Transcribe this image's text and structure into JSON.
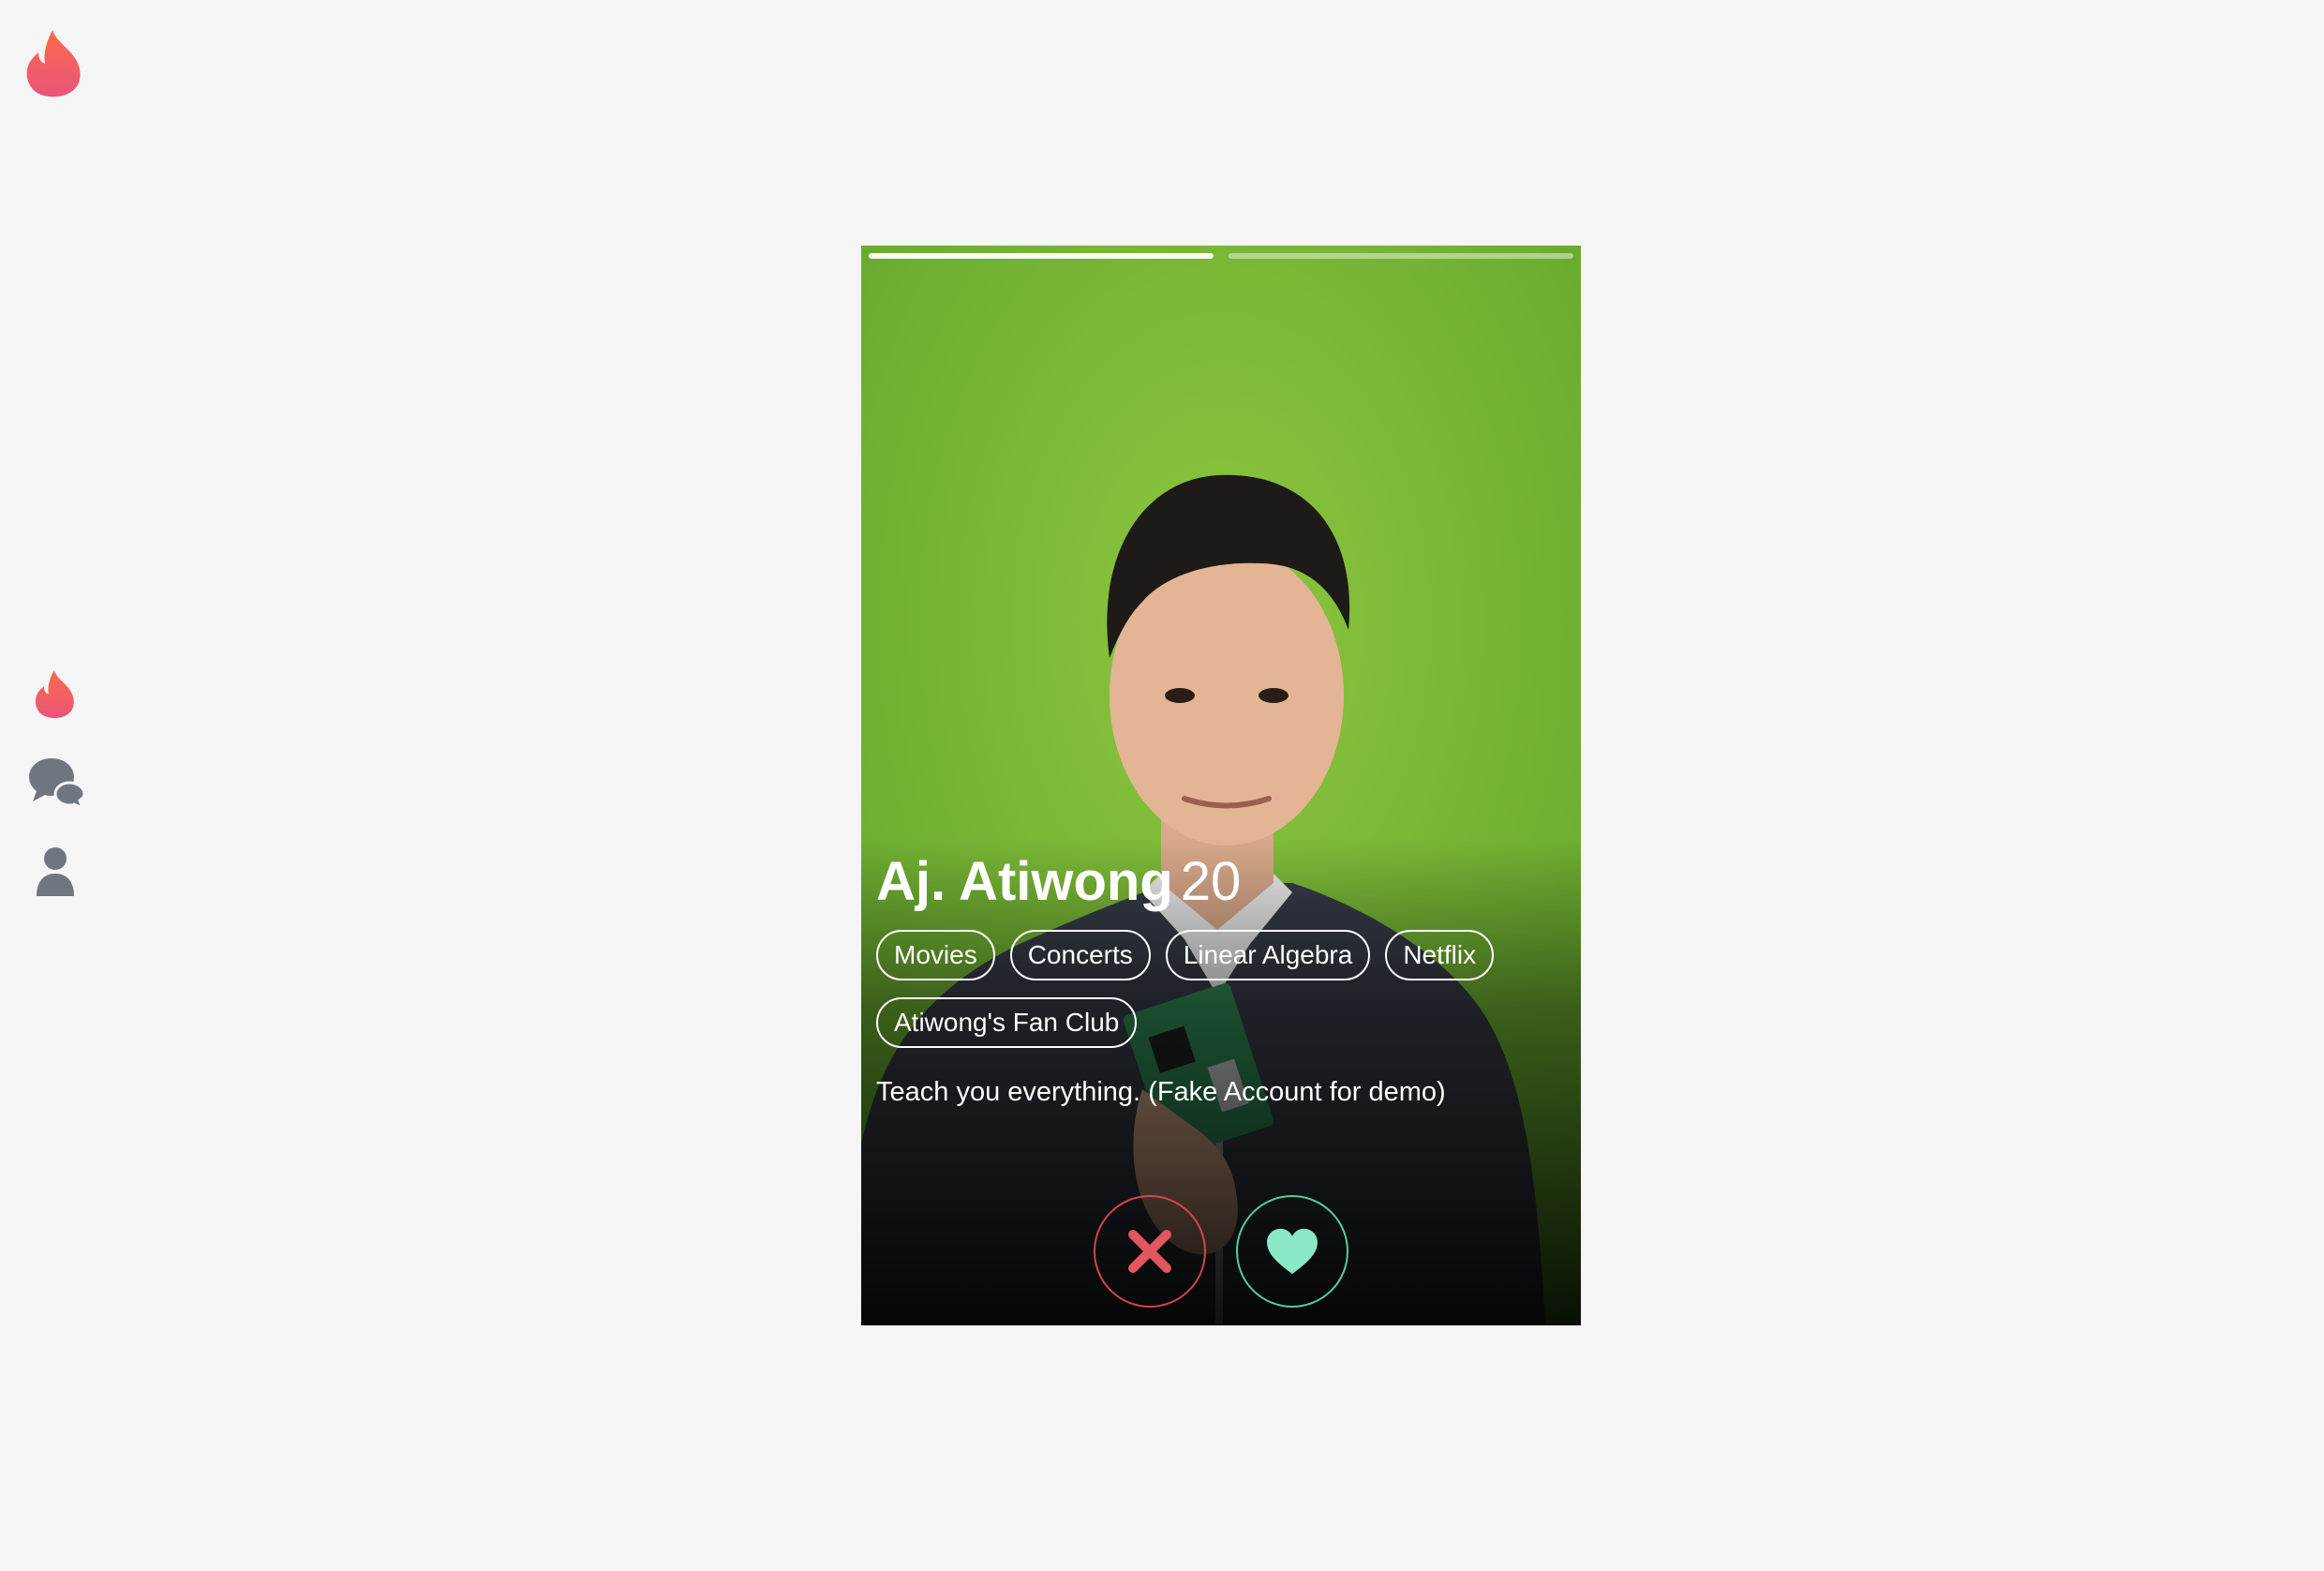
{
  "colors": {
    "brand_top": "#fd5068",
    "brand_bottom": "#e8557a",
    "sidebar_icon": "#6f7680",
    "nope": "#e3555f",
    "like": "#8be8c6",
    "background": "#f5f5f5"
  },
  "icons": {
    "logo": "flame-icon",
    "sidebar": [
      "flame-icon",
      "chat-bubbles-icon",
      "user-icon"
    ],
    "nope": "x-icon",
    "like": "heart-icon"
  },
  "profile": {
    "name": "Aj. Atiwong",
    "age": "20",
    "photo_count": 2,
    "active_photo": 1,
    "tags": [
      "Movies",
      "Concerts",
      "Linear Algebra",
      "Netflix",
      "Atiwong's Fan Club"
    ],
    "bio": "Teach you everything. (Fake Account for demo)"
  }
}
